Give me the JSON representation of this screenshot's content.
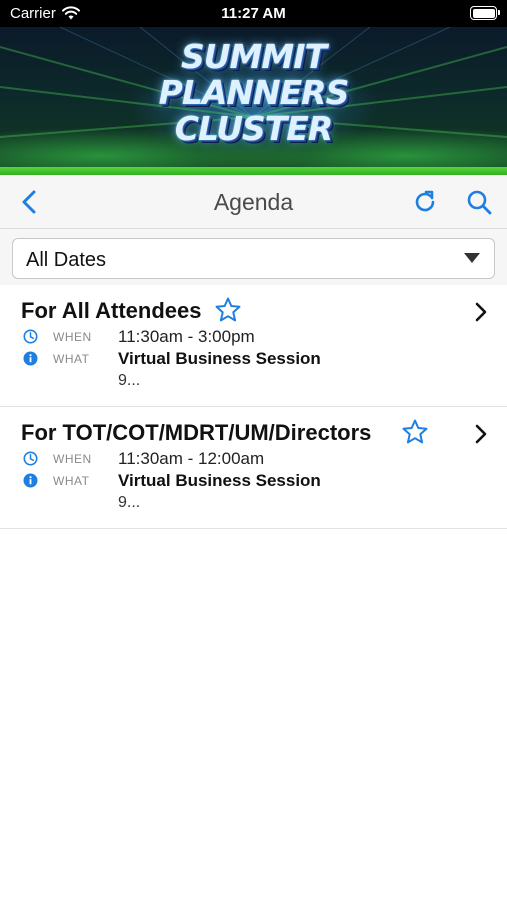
{
  "status_bar": {
    "carrier": "Carrier",
    "time": "11:27 AM",
    "battery_level": 1.0
  },
  "banner": {
    "logo_lines": [
      "SUMMIT",
      "PLANNERS",
      "CLUSTER"
    ]
  },
  "nav": {
    "title": "Agenda",
    "icons": [
      "chevron-left-icon",
      "refresh-icon",
      "search-icon"
    ]
  },
  "filter": {
    "selected": "All Dates"
  },
  "colors": {
    "accent": "#1f7fe0",
    "banner_strip": "#3cbf26"
  },
  "agenda": {
    "items": [
      {
        "title": "For All Attendees",
        "when_label": "WHEN",
        "when": "11:30am - 3:00pm",
        "what_label": "WHAT",
        "what": "Virtual Business Session",
        "description": "9..."
      },
      {
        "title": "For TOT/COT/MDRT/UM/Directors",
        "when_label": "WHEN",
        "when": "11:30am - 12:00am",
        "what_label": "WHAT",
        "what": "Virtual Business Session",
        "description": "9..."
      }
    ]
  }
}
